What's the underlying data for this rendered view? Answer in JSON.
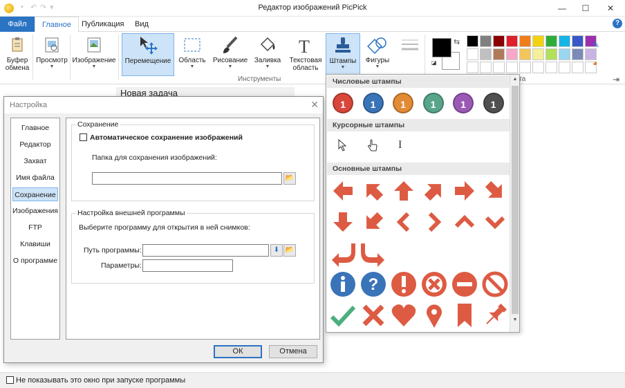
{
  "window": {
    "title": "Редактор изображений PicPick",
    "controls": {
      "minimize": "—",
      "maximize": "☐",
      "close": "✕"
    }
  },
  "tabs": [
    {
      "label": "Файл"
    },
    {
      "label": "Главное"
    },
    {
      "label": "Публикация"
    },
    {
      "label": "Вид"
    }
  ],
  "ribbon": {
    "clipboard": "Буфер обмена",
    "view": "Просмотр",
    "image": "Изображение",
    "move": "Перемещение",
    "area": "Область",
    "draw": "Рисование",
    "fill": "Заливка",
    "text": "Текстовая область",
    "stamps": "Штампы",
    "shapes": "Фигуры",
    "group_tools": "Инструменты",
    "group_palette_tail": "ета",
    "palette": [
      "#000000",
      "#808080",
      "#8b0000",
      "#e0202a",
      "#ee7d1a",
      "#f2d20f",
      "#2fad3b",
      "#17b4e6",
      "#3a58c8",
      "#9b2fae",
      "#ffffff",
      "#c0c0c0",
      "#b07a5a",
      "#f7a8c8",
      "#f3c55a",
      "#f5ef9a",
      "#b2e05a",
      "#9ad6f0",
      "#7b8cb8",
      "#c8b4e2",
      "#ffffff",
      "#ffffff",
      "#ffffff",
      "#ffffff",
      "#ffffff",
      "#ffffff",
      "#ffffff",
      "#ffffff",
      "#ffffff",
      "#ffffff"
    ]
  },
  "document": {
    "tab_title": "Новая задача"
  },
  "bottom": {
    "dont_show": "Не показывать это окно при запуске программы"
  },
  "dialog": {
    "title": "Настройка",
    "nav": [
      "Главное",
      "Редактор",
      "Захват",
      "Имя файла",
      "Сохранение",
      "Изображения",
      "FTP",
      "Клавиши",
      "О программе"
    ],
    "save_group": "Сохранение",
    "auto_save": "Автоматическое сохранение изображений",
    "folder_label": "Папка для сохранения изображений:",
    "ext_group": "Настройка внешней программы",
    "choose_program": "Выберите программу для открытия в ней снимков:",
    "program_path": "Путь программы:",
    "params": "Параметры:",
    "ok": "ОК",
    "cancel": "Отмена"
  },
  "stamps_menu": {
    "numeric": "Числовые штампы",
    "cursor": "Курсорные штампы",
    "basic": "Основные штампы",
    "numbers": [
      {
        "label": "1",
        "color": "#d9473a"
      },
      {
        "label": "1",
        "color": "#3a74b8"
      },
      {
        "label": "1",
        "color": "#e28a35"
      },
      {
        "label": "1",
        "color": "#58a58a"
      },
      {
        "label": "1",
        "color": "#9b59b6"
      },
      {
        "label": "1",
        "color": "#505050"
      }
    ],
    "stamp_color": "#dd5b43",
    "info_color": "#3a74b8",
    "check_color": "#4caf7d"
  }
}
